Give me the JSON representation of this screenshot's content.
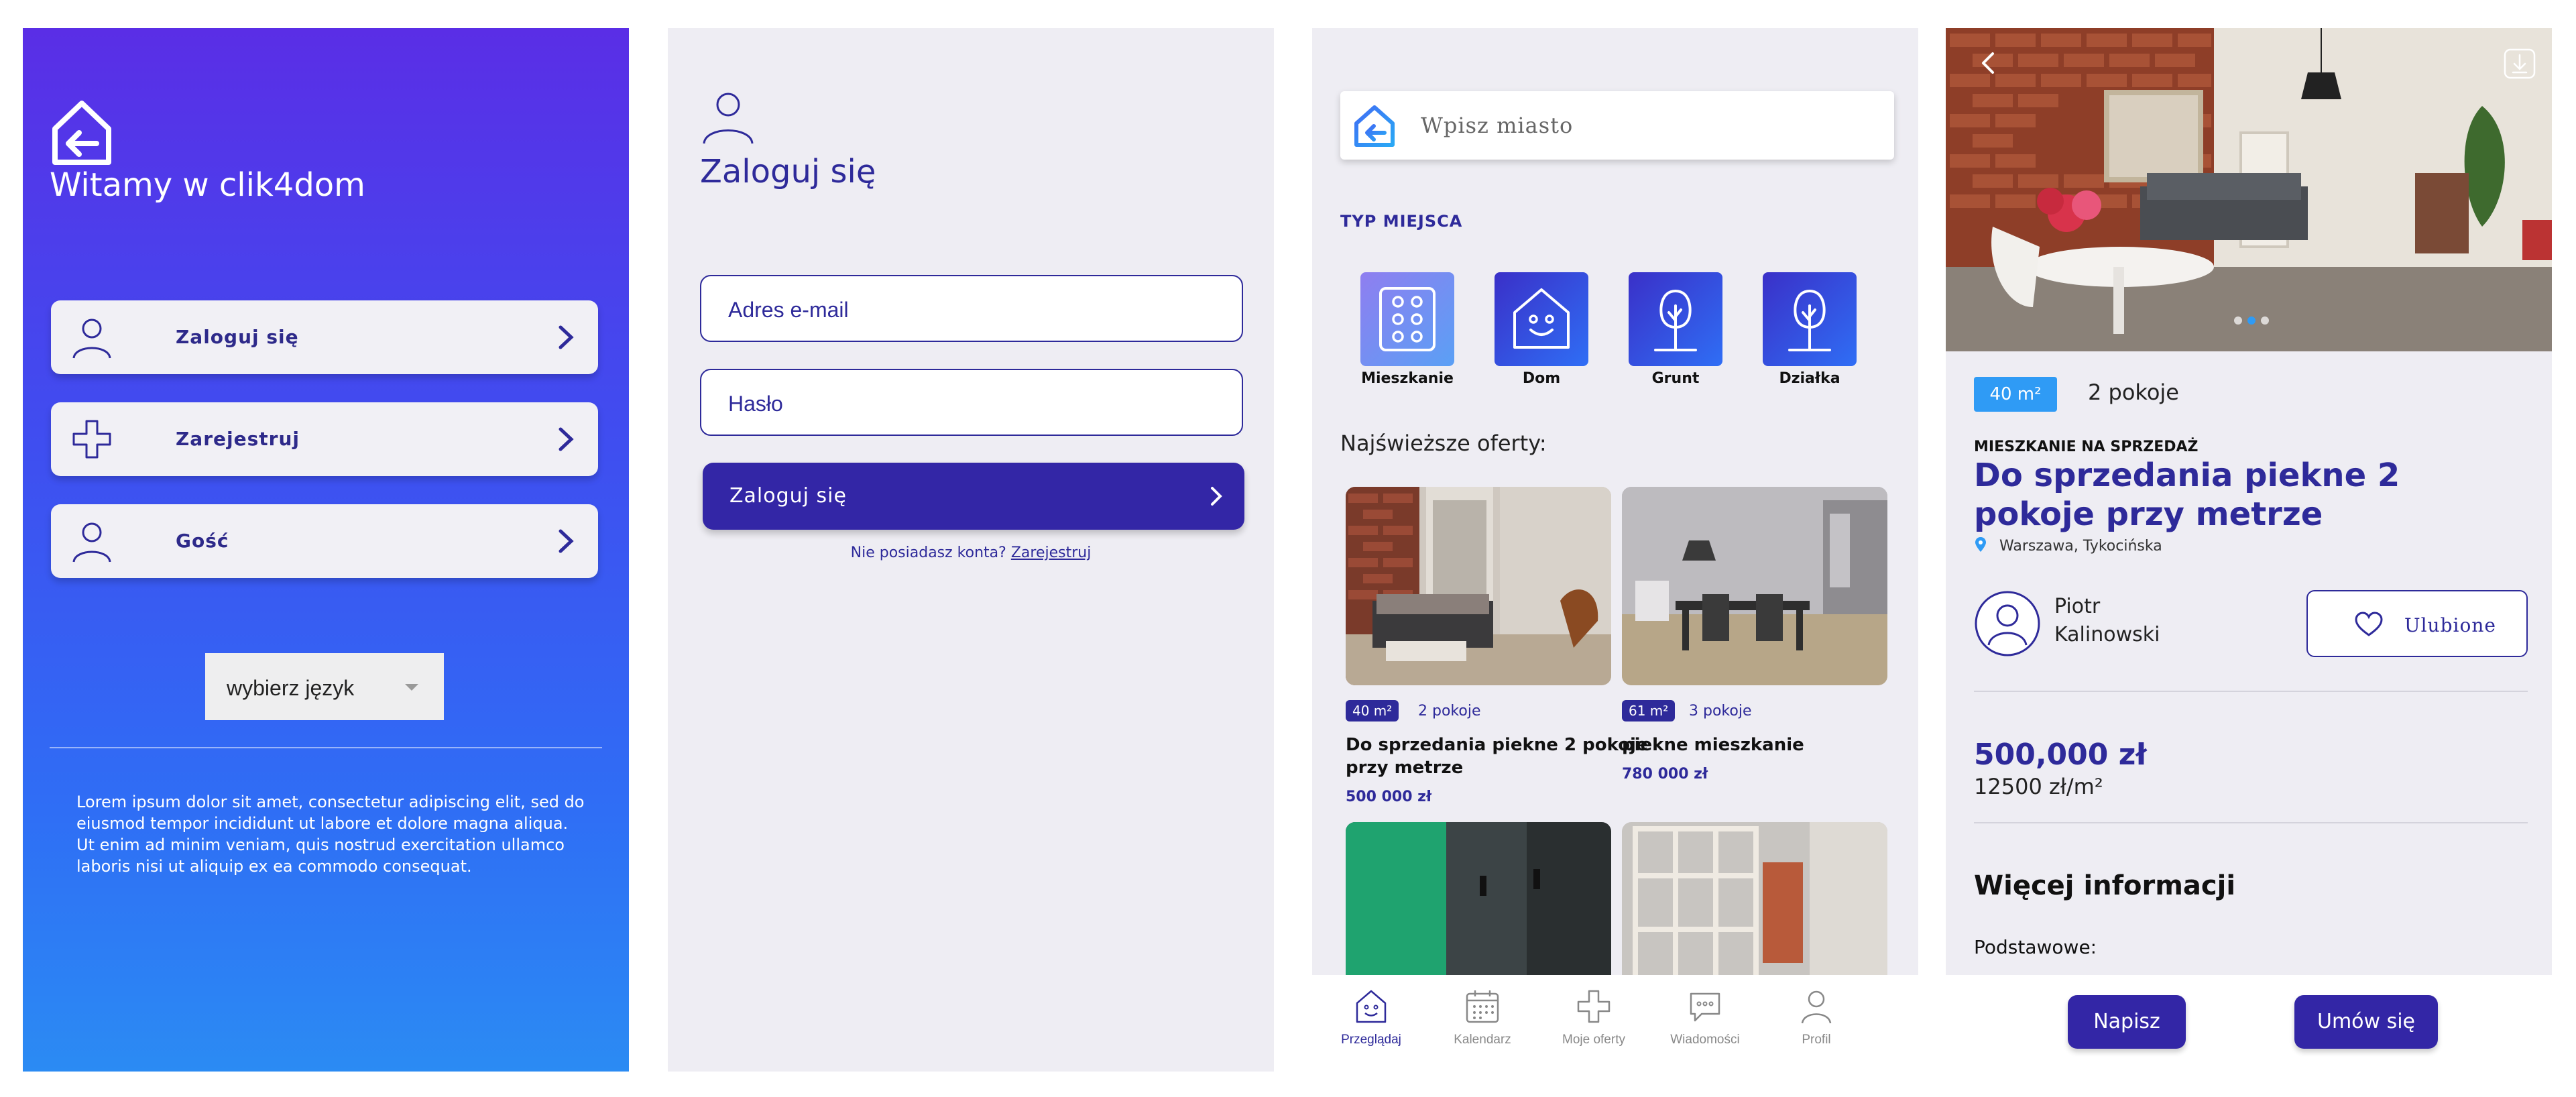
{
  "welcome_screen": {
    "title": "Witamy w clik4dom",
    "menu": [
      {
        "label": "Zaloguj się",
        "icon": "user-icon"
      },
      {
        "label": "Zarejestruj",
        "icon": "plus-icon"
      },
      {
        "label": "Gość",
        "icon": "user-icon"
      }
    ],
    "language_select": "wybierz język",
    "lorem": "Lorem ipsum dolor sit amet, consectetur adipiscing elit, sed do eiusmod tempor incididunt ut labore et dolore magna aliqua. Ut enim ad minim veniam, quis nostrud exercitation ullamco laboris nisi ut aliquip ex ea commodo consequat."
  },
  "login_screen": {
    "title": "Zaloguj się",
    "email_placeholder": "Adres e-mail",
    "password_placeholder": "Hasło",
    "login_button": "Zaloguj się",
    "no_account_text": "Nie posiadasz konta?",
    "register_link": "Zarejestruj"
  },
  "browse_screen": {
    "search_placeholder": "Wpisz miasto",
    "place_type_label": "TYP MIEJSCA",
    "place_types": [
      "Mieszkanie",
      "Dom",
      "Grunt",
      "Działka"
    ],
    "latest_label": "Najświeższe oferty:",
    "offers": [
      {
        "area": "40 m²",
        "rooms": "2 pokoje",
        "title_line1": "Do sprzedania piekne 2 pokoje",
        "title_line2": "przy metrze",
        "price": "500 000 zł"
      },
      {
        "area": "61 m²",
        "rooms": "3 pokoje",
        "title_line1": "piekne mieszkanie",
        "title_line2": "",
        "price": "780 000 zł"
      }
    ],
    "tabs": [
      "Przeglądaj",
      "Kalendarz",
      "Moje oferty",
      "Wiadomości",
      "Profil"
    ]
  },
  "detail_screen": {
    "area": "40 m²",
    "rooms": "2 pokoje",
    "type": "MIESZKANIE NA SPRZEDAŻ",
    "title": "Do sprzedania piekne 2 pokoje przy metrze",
    "location": "Warszawa, Tykocińska",
    "agent_first": "Piotr",
    "agent_last": "Kalinowski",
    "favorite_button": "Ulubione",
    "price": "500,000 zł",
    "price_per_m2": "12500 zł/m²",
    "more_info": "Więcej informacji",
    "basic": "Podstawowe:",
    "write_button": "Napisz",
    "appointment_button": "Umów się"
  },
  "colors": {
    "primary": "#2e2a9a",
    "accent_blue": "#2f9bf5",
    "bg": "#eeedf3"
  }
}
